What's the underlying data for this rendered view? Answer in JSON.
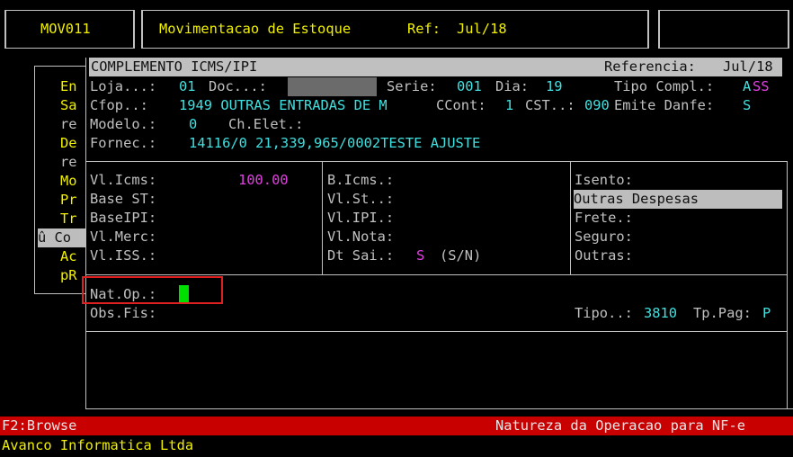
{
  "top": {
    "program_code": "MOV011",
    "title": "Movimentacao de Estoque",
    "ref_label": "Ref:",
    "ref_value": "Jul/18"
  },
  "bg_menu": {
    "items": [
      "En",
      "Sa",
      "re",
      "De",
      "re",
      "Mo",
      "Pr",
      "Tr",
      "û Co",
      "Ac",
      "pR"
    ]
  },
  "dialog": {
    "title": "COMPLEMENTO ICMS/IPI",
    "ref_label": "Referencia:",
    "ref_value": "Jul/18",
    "loja_label": "Loja...:",
    "loja_value": "01",
    "doc_label": "Doc...:",
    "serie_label": "Serie:",
    "serie_value": "001",
    "dia_label": "Dia:",
    "dia_value": "19",
    "tipo_compl_label": "Tipo Compl.:",
    "tipo_compl_value_a": "A",
    "tipo_compl_value_rest": "SS",
    "cfop_label": "Cfop..:",
    "cfop_value": "1949 OUTRAS ENTRADAS DE M",
    "ccont_label": "CCont:",
    "ccont_value": "1",
    "cst_label": "CST..:",
    "cst_value": "090",
    "emite_label": "Emite Danfe:",
    "emite_value": "S",
    "modelo_label": "Modelo.:",
    "modelo_value": "0",
    "chelet_label": "Ch.Elet.:",
    "fornec_label": "Fornec.:",
    "fornec_value": "14116/0 21,339,965/0002TESTE AJUSTE",
    "col1": {
      "vl_icms_label": "Vl.Icms:",
      "vl_icms_value": "100.00",
      "base_st_label": "Base ST:",
      "base_ipi_label": "BaseIPI:",
      "vl_merc_label": "Vl.Merc:",
      "vl_iss_label": "Vl.ISS.:"
    },
    "col2": {
      "b_icms_label": "B.Icms.:",
      "vl_st_label": "Vl.St..:",
      "vl_ipi_label": "Vl.IPI.:",
      "vl_nota_label": "Vl.Nota:",
      "dt_sai_label": "Dt Sai.:",
      "dt_sai_value": "S",
      "dt_sai_hint": "(S/N)"
    },
    "col3": {
      "isento_label": "Isento:",
      "outras_despesas_label": "Outras Despesas",
      "frete_label": "Frete.:",
      "seguro_label": "Seguro:",
      "outras_label": "Outras:"
    },
    "nat_op_label": "Nat.Op.:",
    "obs_fis_label": "Obs.Fis:",
    "tipo_label": "Tipo..:",
    "tipo_value": "3810",
    "tp_pag_label": "Tp.Pag:",
    "tp_pag_value": "P"
  },
  "status": {
    "key_hint": "F2:Browse",
    "message": "Natureza da Operacao para NF-e",
    "company": "Avanco Informatica Ltda"
  },
  "colors": {
    "status_bar": "#c80000",
    "highlight_box": "#e02020",
    "cursor": "#00e000",
    "masked_field": "#6b6b6b"
  }
}
